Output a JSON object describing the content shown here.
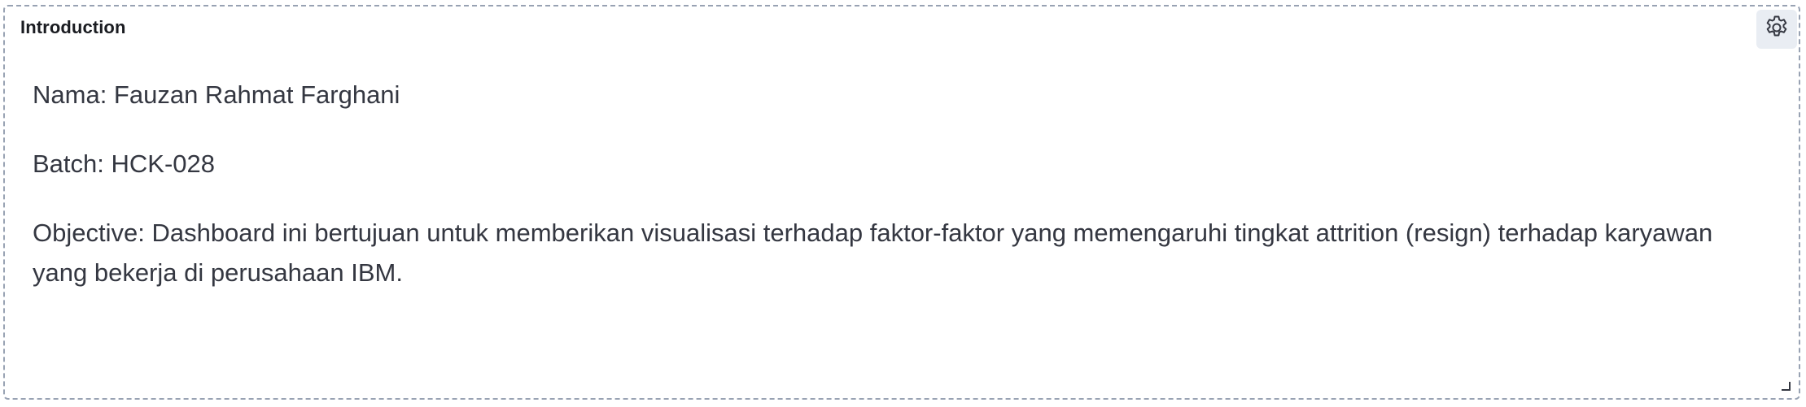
{
  "panel": {
    "title": "Introduction",
    "settings_icon": "gear-icon",
    "resize_icon": "resize-handle-icon"
  },
  "content": {
    "name_line": "Nama: Fauzan Rahmat Farghani",
    "batch_line": "Batch: HCK-028",
    "objective_line": "Objective: Dashboard ini bertujuan untuk memberikan visualisasi terhadap faktor-faktor yang memengaruhi tingkat attrition (resign) terhadap karyawan yang bekerja di perusahaan IBM."
  },
  "colors": {
    "border": "#98a2b3",
    "title": "#1a1c21",
    "text": "#343741",
    "settings_bg": "#e9edf3"
  }
}
